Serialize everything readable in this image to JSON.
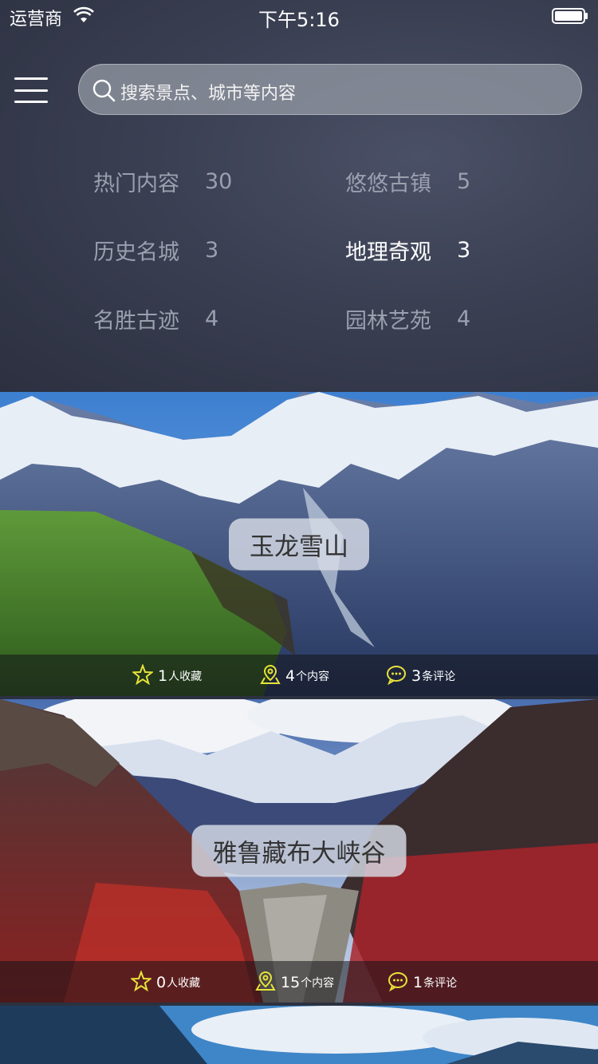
{
  "status_bar": {
    "carrier": "运营商",
    "time": "下午5:16"
  },
  "search": {
    "placeholder": "搜索景点、城市等内容"
  },
  "categories": [
    {
      "name": "热门内容",
      "count": "30"
    },
    {
      "name": "悠悠古镇",
      "count": "5"
    },
    {
      "name": "历史名城",
      "count": "3"
    },
    {
      "name": "地理奇观",
      "count": "3"
    },
    {
      "name": "名胜古迹",
      "count": "4"
    },
    {
      "name": "园林艺苑",
      "count": "4"
    }
  ],
  "cards": [
    {
      "title": "玉龙雪山",
      "favorites_num": "1",
      "favorites_unit": "人收藏",
      "contents_num": "4",
      "contents_unit": "个内容",
      "comments_num": "3",
      "comments_unit": "条评论"
    },
    {
      "title": "雅鲁藏布大峡谷",
      "favorites_num": "0",
      "favorites_unit": "人收藏",
      "contents_num": "15",
      "contents_unit": "个内容",
      "comments_num": "1",
      "comments_unit": "条评论"
    }
  ],
  "colors": {
    "accent_icon": "#e8e23a",
    "active_category": "#ffffff",
    "inactive_category": "#9aa0ae"
  },
  "icons": [
    "wifi-icon",
    "battery-icon",
    "menu-icon",
    "search-icon",
    "star-icon",
    "location-icon",
    "comment-icon"
  ]
}
